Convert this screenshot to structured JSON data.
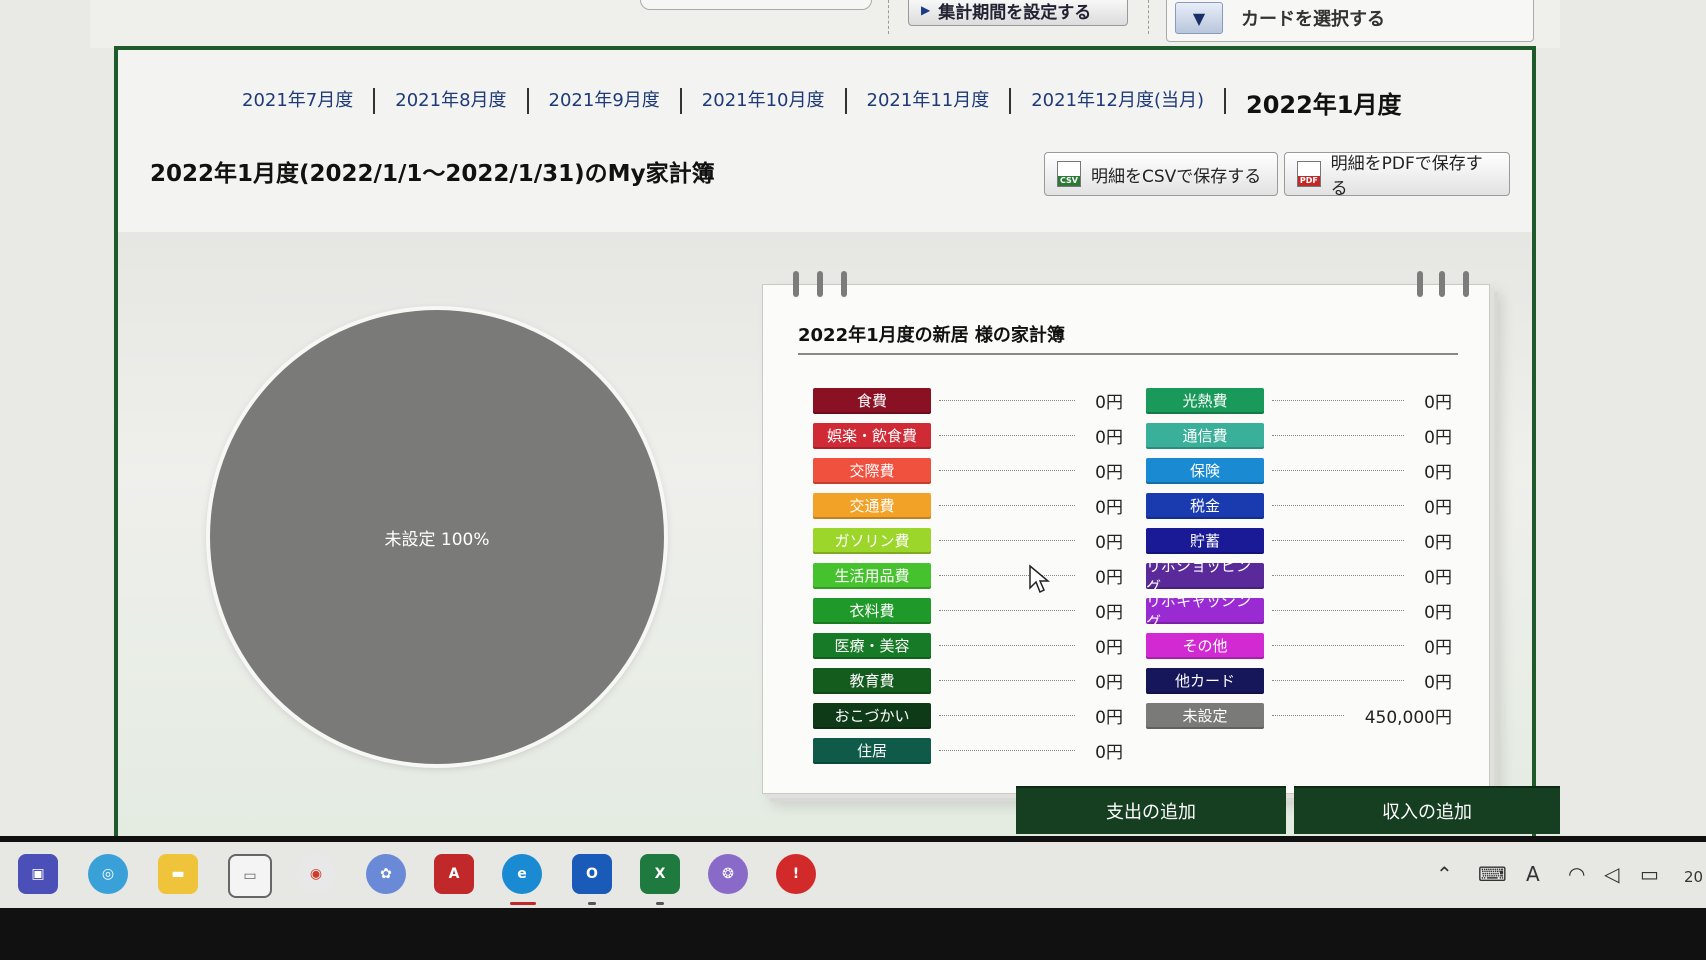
{
  "top": {
    "period_button": "集計期間を設定する",
    "card_select": "カードを選択する"
  },
  "months": [
    {
      "label": "2021年7月度"
    },
    {
      "label": "2021年8月度"
    },
    {
      "label": "2021年9月度"
    },
    {
      "label": "2021年10月度"
    },
    {
      "label": "2021年11月度"
    },
    {
      "label": "2021年12月度(当月)"
    },
    {
      "label": "2022年1月度"
    }
  ],
  "page_title": "2022年1月度(2022/1/1～2022/1/31)のMy家計簿",
  "export": {
    "csv_label": "明細をCSVで保存する",
    "csv_icon_text": "CSV",
    "pdf_label": "明細をPDFで保存する",
    "pdf_icon_text": "PDF"
  },
  "pie": {
    "label": "未設定 100%",
    "slices": [
      {
        "name": "未設定",
        "percent": 100,
        "color": "#7a7a78"
      }
    ]
  },
  "notebook_title": "2022年1月度の新居 様の家計簿",
  "categories_left": [
    {
      "name": "食費",
      "amount": "0円",
      "color": "#8a1024"
    },
    {
      "name": "娯楽・飲食費",
      "amount": "0円",
      "color": "#d02a36"
    },
    {
      "name": "交際費",
      "amount": "0円",
      "color": "#f0503e"
    },
    {
      "name": "交通費",
      "amount": "0円",
      "color": "#f2a227"
    },
    {
      "name": "ガソリン費",
      "amount": "0円",
      "color": "#9cd62a"
    },
    {
      "name": "生活用品費",
      "amount": "0円",
      "color": "#46c22e"
    },
    {
      "name": "衣料費",
      "amount": "0円",
      "color": "#1f9a2a"
    },
    {
      "name": "医療・美容",
      "amount": "0円",
      "color": "#177a26"
    },
    {
      "name": "教育費",
      "amount": "0円",
      "color": "#135c1e"
    },
    {
      "name": "おこづかい",
      "amount": "0円",
      "color": "#0f3a18"
    },
    {
      "name": "住居",
      "amount": "0円",
      "color": "#0f5a48"
    }
  ],
  "categories_right": [
    {
      "name": "光熱費",
      "amount": "0円",
      "color": "#1a9a5a"
    },
    {
      "name": "通信費",
      "amount": "0円",
      "color": "#3ab09a"
    },
    {
      "name": "保険",
      "amount": "0円",
      "color": "#1a8ad2"
    },
    {
      "name": "税金",
      "amount": "0円",
      "color": "#1a3ab0"
    },
    {
      "name": "貯蓄",
      "amount": "0円",
      "color": "#1a1a96"
    },
    {
      "name": "リボショッピング",
      "amount": "0円",
      "color": "#5a2a9a"
    },
    {
      "name": "リボキャッシング",
      "amount": "0円",
      "color": "#9a2ad2"
    },
    {
      "name": "その他",
      "amount": "0円",
      "color": "#d22ad2"
    },
    {
      "name": "他カード",
      "amount": "0円",
      "color": "#16165a"
    },
    {
      "name": "未設定",
      "amount": "450,000円",
      "color": "#7a7a78"
    }
  ],
  "actions": {
    "add_expense": "支出の追加",
    "add_income": "収入の追加"
  },
  "taskbar": {
    "clock_partial": "20"
  }
}
